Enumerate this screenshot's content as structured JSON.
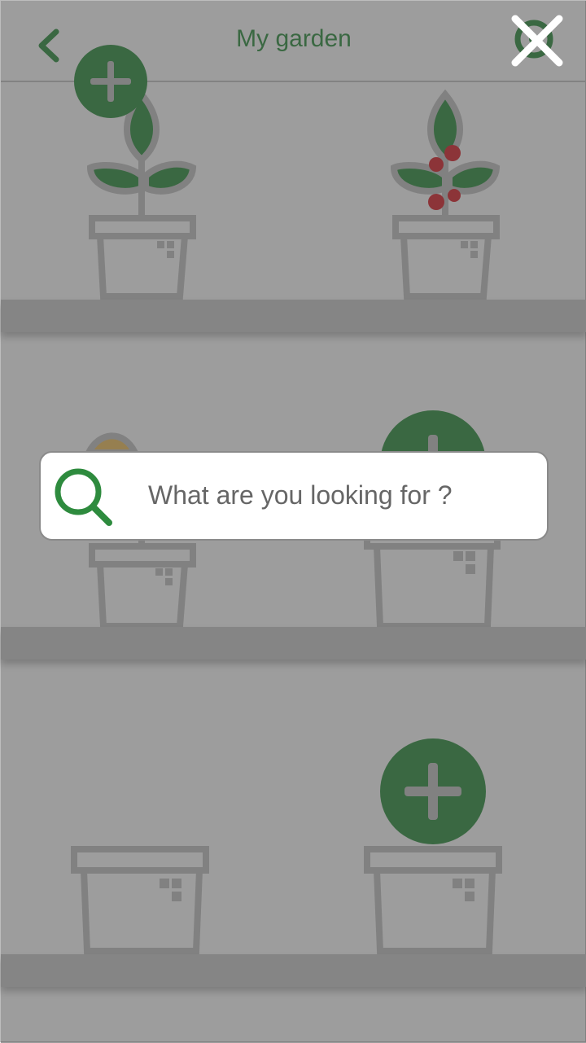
{
  "header": {
    "title": "My garden"
  },
  "search": {
    "placeholder": "What are you looking for ?"
  },
  "icons": {
    "back": "chevron-left-icon",
    "settings": "settings-icon",
    "close": "close-icon",
    "search": "search-icon",
    "add": "plus-icon"
  },
  "colors": {
    "accent": "#2e8b3e",
    "pot": "#bdbdbd",
    "berry": "#d2232a",
    "shelf": "#c4c4c4",
    "overlay": "rgba(70,70,70,0.5)"
  }
}
